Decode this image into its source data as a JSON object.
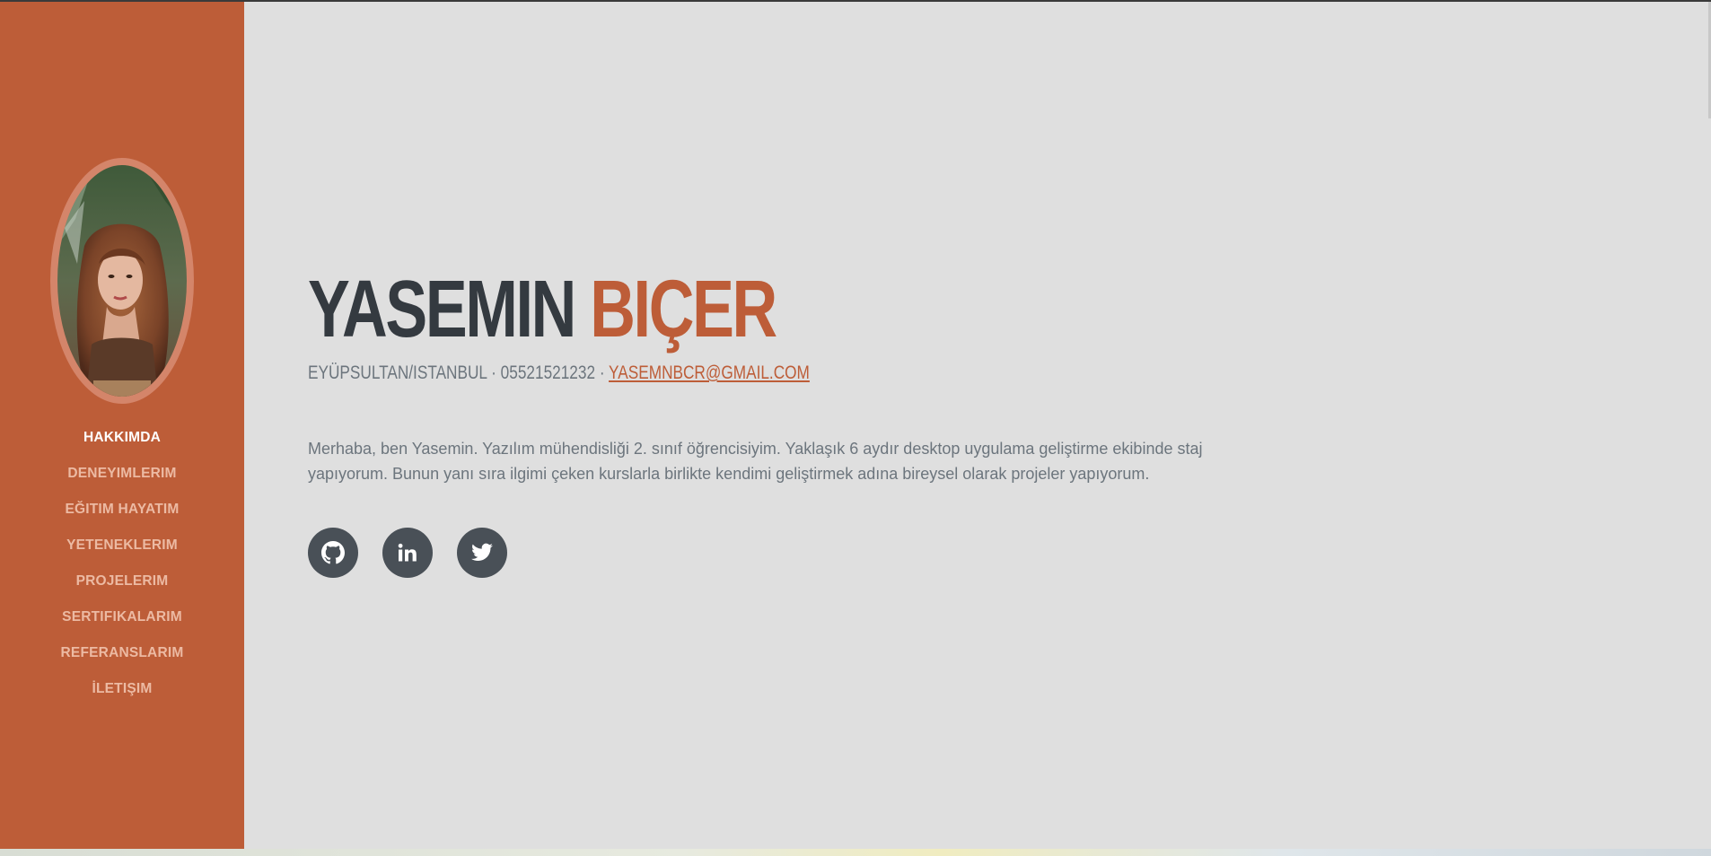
{
  "profile": {
    "first_name": "YASEMIN",
    "last_name": "BIÇER",
    "location": "EYÜPSULTAN/ISTANBUL",
    "separator_1": "·",
    "phone": "05521521232",
    "separator_2": "·",
    "email": "YASEMNBCR@GMAIL.COM",
    "about": "Merhaba, ben Yasemin. Yazılım mühendisliği 2. sınıf öğrencisiyim. Yaklaşık 6 aydır desktop uygulama geliştirme ekibinde staj yapıyorum. Bunun yanı sıra ilgimi çeken kurslarla birlikte kendimi geliştirmek adına bireysel olarak projeler yapıyorum."
  },
  "sidebar": {
    "items": [
      {
        "label": "HAKKIMDA",
        "active": true
      },
      {
        "label": "DENEYIMLERIM",
        "active": false
      },
      {
        "label": "EĞITIM HAYATIM",
        "active": false
      },
      {
        "label": "YETENEKLERIM",
        "active": false
      },
      {
        "label": "PROJELERIM",
        "active": false
      },
      {
        "label": "SERTIFIKALARIM",
        "active": false
      },
      {
        "label": "REFERANSLARIM",
        "active": false
      },
      {
        "label": "İLETIŞIM",
        "active": false
      }
    ]
  },
  "social": [
    {
      "icon": "github-icon"
    },
    {
      "icon": "linkedin-icon"
    },
    {
      "icon": "twitter-icon"
    }
  ],
  "colors": {
    "primary": "#bd5d38",
    "sidebar_bg": "#bd5d38",
    "main_bg": "#dfdfdf",
    "heading_dark": "#343a40",
    "text_muted": "#6c757d",
    "social_bg": "#495057"
  }
}
